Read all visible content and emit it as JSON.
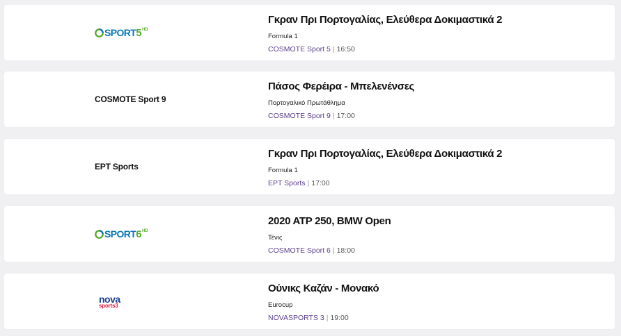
{
  "schedule": [
    {
      "logo_type": "sport",
      "logo": {
        "word": "SPORT",
        "number": "5",
        "hd": "HD"
      },
      "title": "Γκραν Πρι Πορτογαλίας, Ελεύθερα Δοκιμαστικά 2",
      "subtitle": "Formula 1",
      "channel": "COSMOTE Sport 5",
      "separator": "|",
      "time": "16:50"
    },
    {
      "logo_type": "text",
      "logo": {
        "text": "COSMOTE Sport 9"
      },
      "title": "Πάσος Φερέιρα - Μπελενένσες",
      "subtitle": "Πορτογαλικό Πρωτάθλημα",
      "channel": "COSMOTE Sport 9",
      "separator": "|",
      "time": "17:00"
    },
    {
      "logo_type": "text",
      "logo": {
        "text": "EPT Sports"
      },
      "title": "Γκραν Πρι Πορτογαλίας, Ελεύθερα Δοκιμαστικά 2",
      "subtitle": "Formula 1",
      "channel": "EPT Sports",
      "separator": "|",
      "time": "17:00"
    },
    {
      "logo_type": "sport",
      "logo": {
        "word": "SPORT",
        "number": "6",
        "hd": "HD"
      },
      "title": "2020 ATP 250, BMW Open",
      "subtitle": "Τένις",
      "channel": "COSMOTE Sport 6",
      "separator": "|",
      "time": "18:00"
    },
    {
      "logo_type": "nova",
      "logo": {
        "word": "nova",
        "sub": "sports3"
      },
      "title": "Ούνικς Καζάν - Μονακό",
      "subtitle": "Eurocup",
      "channel": "NOVASPORTS 3",
      "separator": "|",
      "time": "19:00"
    }
  ],
  "colors": {
    "background": "#f0f0f2",
    "card": "#ffffff",
    "channel_link": "#5b3f8c",
    "sport_blue": "#0a78b6",
    "sport_green": "#5aab2e",
    "nova_blue": "#1c3f8f",
    "nova_red": "#e0193c"
  }
}
